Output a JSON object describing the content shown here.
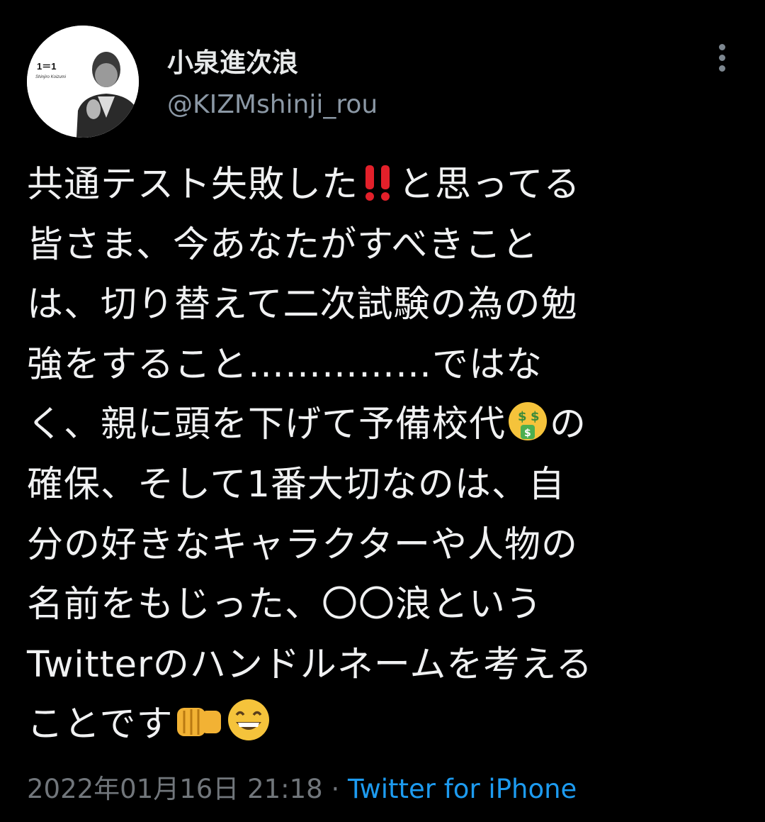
{
  "profile": {
    "display_name": "小泉進次浪",
    "handle": "@KIZMshinji_rou",
    "avatar_text": "1＝1",
    "avatar_subtext": "Shinjiro Koizumi"
  },
  "tweet": {
    "lines": [
      [
        "共通テスト失敗した",
        "‼️",
        "と思ってる"
      ],
      [
        "皆さま、今あなたがすべきこと"
      ],
      [
        "は、切り替えて二次試験の為の勉"
      ],
      [
        "強をすること……………ではな"
      ],
      [
        "く、親に頭を下げて予備校代",
        "🤑",
        "の"
      ],
      [
        "確保、そして1番大切なのは、自"
      ],
      [
        "分の好きなキャラクターや人物の"
      ],
      [
        "名前をもじった、〇〇浪という"
      ],
      [
        "Twitterのハンドルネームを考える"
      ],
      [
        "ことです",
        "👊",
        "😁"
      ]
    ]
  },
  "footer": {
    "timestamp": "2022年01月16日 21:18",
    "separator": " · ",
    "source": "Twitter for iPhone"
  },
  "icons": {
    "more": "more-vertical-icon",
    "double_exclamation": "double-exclamation-emoji",
    "money_mouth": "money-mouth-emoji",
    "fist": "oncoming-fist-emoji",
    "grin": "grinning-face-emoji"
  },
  "colors": {
    "background": "#000000",
    "text": "#e7e9ea",
    "secondary": "#71767b",
    "link": "#1d9bf0"
  }
}
